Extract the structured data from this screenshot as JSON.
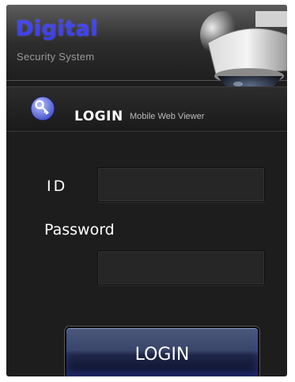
{
  "header": {
    "brand_title": "Digital",
    "brand_subtitle": "Security System"
  },
  "login_bar": {
    "title": "LOGIN",
    "subtitle": "Mobile Web Viewer"
  },
  "form": {
    "id_label": "ID",
    "id_value": "",
    "password_label": "Password",
    "password_value": "",
    "login_button": "LOGIN"
  },
  "colors": {
    "brand_blue": "#3a3df0",
    "background": "#1d1d1d",
    "button_blue": "#39456a"
  }
}
